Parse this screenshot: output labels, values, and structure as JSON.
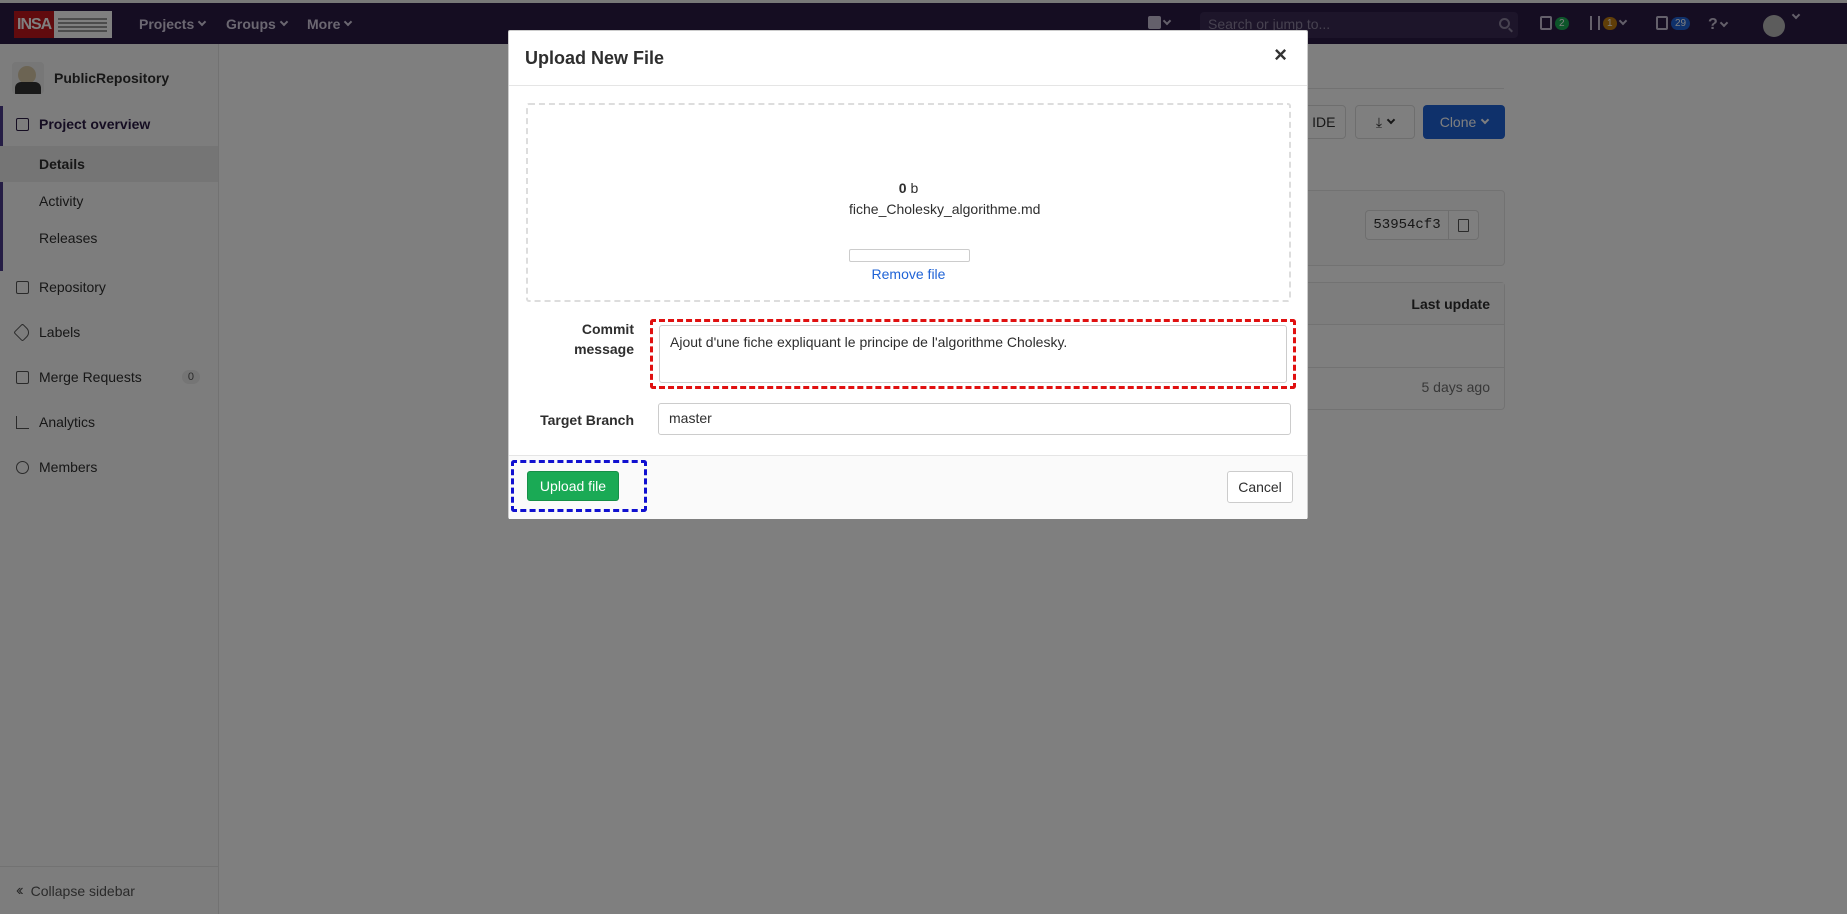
{
  "topbar": {
    "nav": [
      {
        "label": "Projects"
      },
      {
        "label": "Groups"
      },
      {
        "label": "More"
      }
    ],
    "search_placeholder": "Search or jump to...",
    "issues_count": "2",
    "mr_count": "1",
    "todos_count": "29"
  },
  "sidebar": {
    "project_name": "PublicRepository",
    "project_overview": "Project overview",
    "sub_items": [
      "Details",
      "Activity",
      "Releases"
    ],
    "repository": "Repository",
    "labels": "Labels",
    "merge_requests": "Merge Requests",
    "merge_requests_count": "0",
    "analytics": "Analytics",
    "members": "Members",
    "collapse": "Collapse sidebar"
  },
  "background": {
    "web_ide_partial": "b IDE",
    "clone_label": "Clone",
    "commit_sha": "53954cf3",
    "last_update_header": "Last update",
    "last_update_value": "5 days ago"
  },
  "modal": {
    "title": "Upload New File",
    "close_glyph": "×",
    "file_size_value": "0",
    "file_size_unit": "b",
    "file_name": "fiche_Cholesky_algorithme.md",
    "upload_progress": 0,
    "remove_file": "Remove file",
    "commit_label_line1": "Commit",
    "commit_label_line2": "message",
    "commit_message": "Ajout d'une fiche expliquant le principe de l'algorithme Cholesky.",
    "target_branch_label": "Target Branch",
    "target_branch_value": "master",
    "upload_button": "Upload file",
    "cancel_button": "Cancel"
  },
  "colors": {
    "navbar": "#2b1a45",
    "primary_green": "#1aaa55",
    "link_blue": "#1f63d6",
    "highlight_red": "#e01010",
    "highlight_blue": "#1010d0"
  }
}
